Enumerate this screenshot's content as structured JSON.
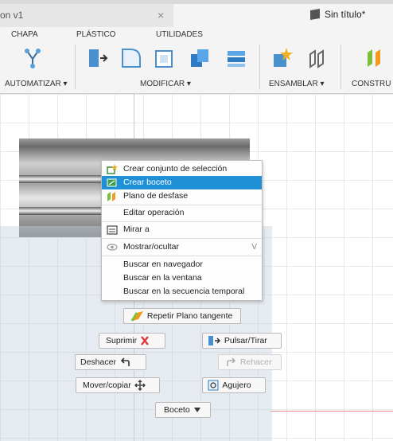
{
  "tabs": [
    {
      "label": "on v1",
      "close": "×"
    },
    {
      "label": "Sin título*"
    }
  ],
  "toolbar": {
    "tabs": [
      "CHAPA",
      "PLÁSTICO",
      "UTILIDADES"
    ],
    "groups": [
      "AUTOMATIZAR",
      "MODIFICAR",
      "ENSAMBLAR",
      "CONSTRU"
    ],
    "dropdown_arrow": "▾"
  },
  "context_menu": {
    "items": [
      {
        "label": "Crear conjunto de selección",
        "icon": "selection-set-icon"
      },
      {
        "label": "Crear boceto",
        "icon": "sketch-icon",
        "selected": true
      },
      {
        "label": "Plano de desfase",
        "icon": "offset-plane-icon"
      },
      {
        "label": "Editar operación"
      },
      {
        "label": "Mirar a",
        "icon": "look-at-icon"
      },
      {
        "label": "Mostrar/ocultar",
        "icon": "eye-icon",
        "shortcut": "V"
      },
      {
        "label": "Buscar en navegador"
      },
      {
        "label": "Buscar en la ventana"
      },
      {
        "label": "Buscar en la secuencia temporal"
      }
    ]
  },
  "marking_menu": {
    "repeat": "Repetir Plano tangente",
    "suprimir": "Suprimir",
    "pulsar": "Pulsar/Tirar",
    "deshacer": "Deshacer",
    "rehacer": "Rehacer",
    "mover": "Mover/copiar",
    "agujero": "Agujero",
    "boceto": "Boceto"
  },
  "colors": {
    "accent": "#1f8fd6",
    "delete": "#e03a3a"
  }
}
